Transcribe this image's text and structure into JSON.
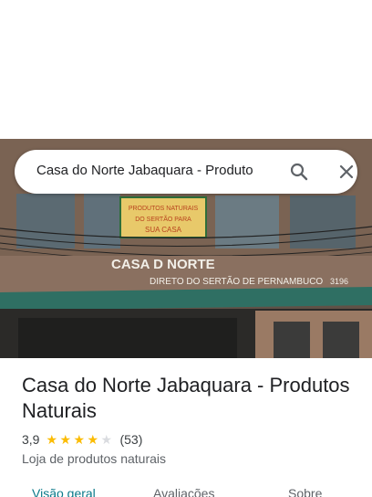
{
  "search": {
    "query": "Casa do Norte Jabaquara - Produto",
    "search_icon": "search-icon",
    "close_icon": "close-icon"
  },
  "photo": {
    "sign_text": "CASA D   NORTE",
    "sign_subtitle": "DIRETO DO SERTÃO DE PERNAMBUCO",
    "street_number": "3196",
    "banner_line1": "PRODUTOS NATURAIS",
    "banner_line2": "DO SERTÃO PARA",
    "banner_line3": "SUA CASA"
  },
  "place": {
    "title": "Casa do Norte Jabaquara - Produtos Naturais",
    "rating": "3,9",
    "stars_filled": 4,
    "stars_total": 5,
    "review_count": "(53)",
    "category": "Loja de produtos naturais"
  },
  "tabs": [
    {
      "label": "Visão geral",
      "active": true
    },
    {
      "label": "Avaliações",
      "active": false
    },
    {
      "label": "Sobre",
      "active": false
    }
  ],
  "colors": {
    "star": "#fbbc04",
    "star_empty": "#dadce0",
    "active_tab": "#0b7a8a"
  }
}
